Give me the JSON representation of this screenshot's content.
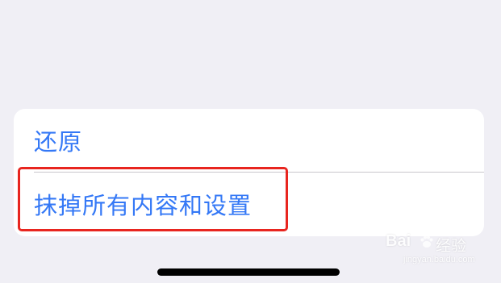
{
  "settings_group": {
    "items": [
      {
        "label": "还原"
      },
      {
        "label": "抹掉所有内容和设置"
      }
    ]
  },
  "annotation": {
    "highlight_color": "#e8251f",
    "highlighted_item": "抹掉所有内容和设置"
  },
  "colors": {
    "background": "#f0eff5",
    "card": "#ffffff",
    "link_blue": "#3478f6",
    "divider": "#c8c7cc"
  },
  "watermark": {
    "brand_text": "Bai",
    "brand_suffix": "经验",
    "url": "jingyan.baidu.com",
    "icon": "paw-icon"
  }
}
